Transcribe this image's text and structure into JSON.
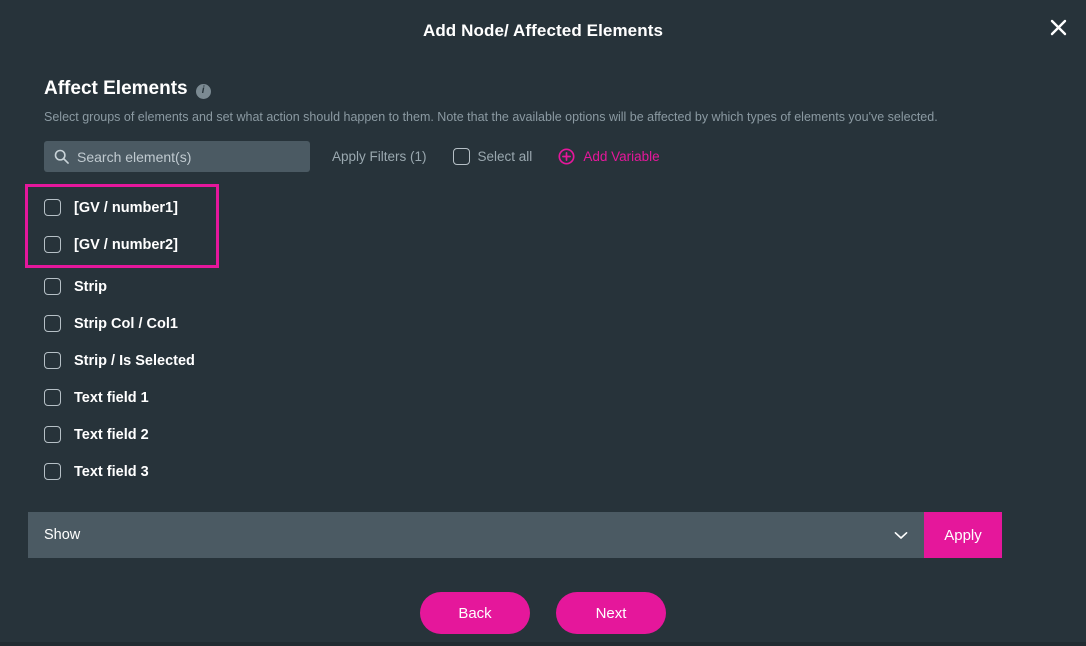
{
  "modal": {
    "title": "Add Node/ Affected Elements",
    "close_icon": "close-icon"
  },
  "section": {
    "title": "Affect Elements",
    "info_icon_label": "i",
    "description": "Select groups of elements and set what action should happen to them. Note that the available options will be affected by which types of elements you've selected."
  },
  "toolbar": {
    "search_placeholder": "Search element(s)",
    "search_value": "",
    "search_icon": "search-icon",
    "apply_filters_label": "Apply Filters (1)",
    "select_all_label": "Select all",
    "add_variable_label": "Add Variable",
    "add_variable_icon": "plus-circle-icon"
  },
  "elements": {
    "highlighted": [
      {
        "label": "[GV / number1]",
        "checked": false
      },
      {
        "label": "[GV / number2]",
        "checked": false
      }
    ],
    "rest": [
      {
        "label": "Strip",
        "checked": false
      },
      {
        "label": "Strip Col / Col1",
        "checked": false
      },
      {
        "label": "Strip / Is Selected",
        "checked": false
      },
      {
        "label": "Text field 1",
        "checked": false
      },
      {
        "label": "Text field 2",
        "checked": false
      },
      {
        "label": "Text field 3",
        "checked": false
      }
    ]
  },
  "action_bar": {
    "dropdown_value": "Show",
    "dropdown_icon": "chevron-down-icon",
    "apply_label": "Apply"
  },
  "footer": {
    "back_label": "Back",
    "next_label": "Next"
  },
  "colors": {
    "background": "#27333a",
    "accent": "#e5179b",
    "field": "#4b5a63",
    "muted_text": "#8b9aa2"
  }
}
